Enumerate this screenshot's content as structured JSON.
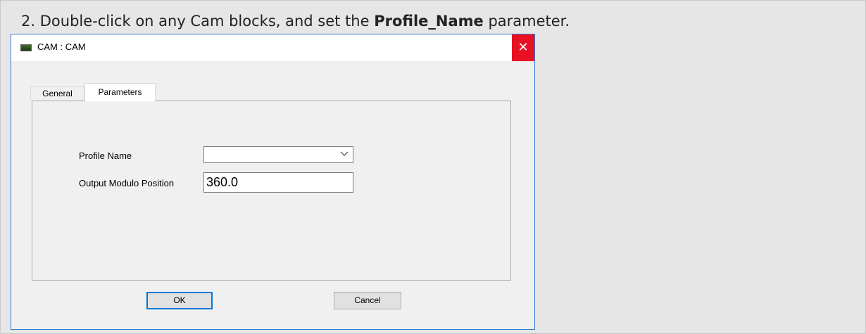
{
  "instruction": {
    "number": "2.",
    "before": "Double-click on any Cam blocks, and set the ",
    "emphasis": "Profile_Name",
    "after": " parameter."
  },
  "dialog": {
    "title": "CAM : CAM",
    "close_symbol": "✕",
    "tabs": [
      {
        "label": "General",
        "active": false
      },
      {
        "label": "Parameters",
        "active": true
      }
    ],
    "fields": {
      "profile_name_label": "Profile Name",
      "profile_name_value": "",
      "output_modulo_label": "Output Modulo Position",
      "output_modulo_value": "360.0"
    },
    "buttons": {
      "ok": "OK",
      "cancel": "Cancel"
    },
    "icons": {
      "title_icon": "application-icon",
      "close_icon": "close-icon",
      "dropdown_icon": "chevron-down-icon"
    },
    "colors": {
      "close_bg": "#e81123",
      "border_accent": "#2e7ad1",
      "ok_focus": "#0078d7"
    }
  }
}
